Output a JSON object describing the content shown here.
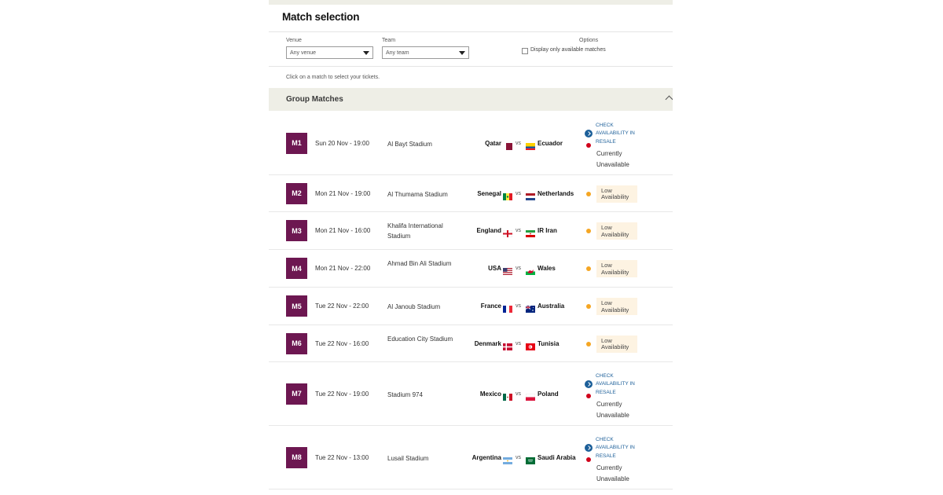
{
  "header": {
    "title": "Match selection"
  },
  "filters": {
    "venue_label": "Venue",
    "venue_value": "Any venue",
    "team_label": "Team",
    "team_value": "Any team",
    "options_label": "Options",
    "available_only_label": "Display only available matches",
    "available_only_checked": false
  },
  "hint": "Click on a match to select your tickets.",
  "group": {
    "title": "Group Matches",
    "expanded": true
  },
  "vs_label": "vs",
  "status_text": {
    "check": "CHECK AVAILABILITY IN RESALE",
    "unavailable": "Currently Unavailable",
    "low": "Low Availability"
  },
  "colors": {
    "badge": "#6d1751",
    "low_dot": "#f5a623",
    "unavailable_dot": "#d0021b",
    "link": "#1c5f99",
    "low_bg": "#fdf3e2"
  },
  "matches": [
    {
      "code": "M1",
      "date": "Sun 20 Nov - 19:00",
      "venue": "Al Bayt Stadium",
      "home": "Qatar",
      "home_flag": "qatar-flag-icon",
      "away": "Ecuador",
      "away_flag": "ecuador-flag-icon",
      "status": "resale"
    },
    {
      "code": "M2",
      "date": "Mon 21 Nov - 19:00",
      "venue": "Al Thumama Stadium",
      "home": "Senegal",
      "home_flag": "senegal-flag-icon",
      "away": "Netherlands",
      "away_flag": "netherlands-flag-icon",
      "status": "low"
    },
    {
      "code": "M3",
      "date": "Mon 21 Nov - 16:00",
      "venue": "Khalifa International Stadium",
      "home": "England",
      "home_flag": "england-flag-icon",
      "away": "IR Iran",
      "away_flag": "iran-flag-icon",
      "status": "low"
    },
    {
      "code": "M4",
      "date": "Mon 21 Nov - 22:00",
      "venue": "Ahmad Bin Ali Stadium",
      "home": "USA",
      "home_flag": "usa-flag-icon",
      "away": "Wales",
      "away_flag": "wales-flag-icon",
      "status": "low"
    },
    {
      "code": "M5",
      "date": "Tue 22 Nov - 22:00",
      "venue": "Al Janoub Stadium",
      "home": "France",
      "home_flag": "france-flag-icon",
      "away": "Australia",
      "away_flag": "australia-flag-icon",
      "status": "low"
    },
    {
      "code": "M6",
      "date": "Tue 22 Nov - 16:00",
      "venue": "Education City Stadium",
      "home": "Denmark",
      "home_flag": "denmark-flag-icon",
      "away": "Tunisia",
      "away_flag": "tunisia-flag-icon",
      "status": "low"
    },
    {
      "code": "M7",
      "date": "Tue 22 Nov - 19:00",
      "venue": "Stadium 974",
      "home": "Mexico",
      "home_flag": "mexico-flag-icon",
      "away": "Poland",
      "away_flag": "poland-flag-icon",
      "status": "resale"
    },
    {
      "code": "M8",
      "date": "Tue 22 Nov - 13:00",
      "venue": "Lusail Stadium",
      "home": "Argentina",
      "home_flag": "argentina-flag-icon",
      "away": "Saudi Arabia",
      "away_flag": "saudi-arabia-flag-icon",
      "status": "resale"
    }
  ]
}
